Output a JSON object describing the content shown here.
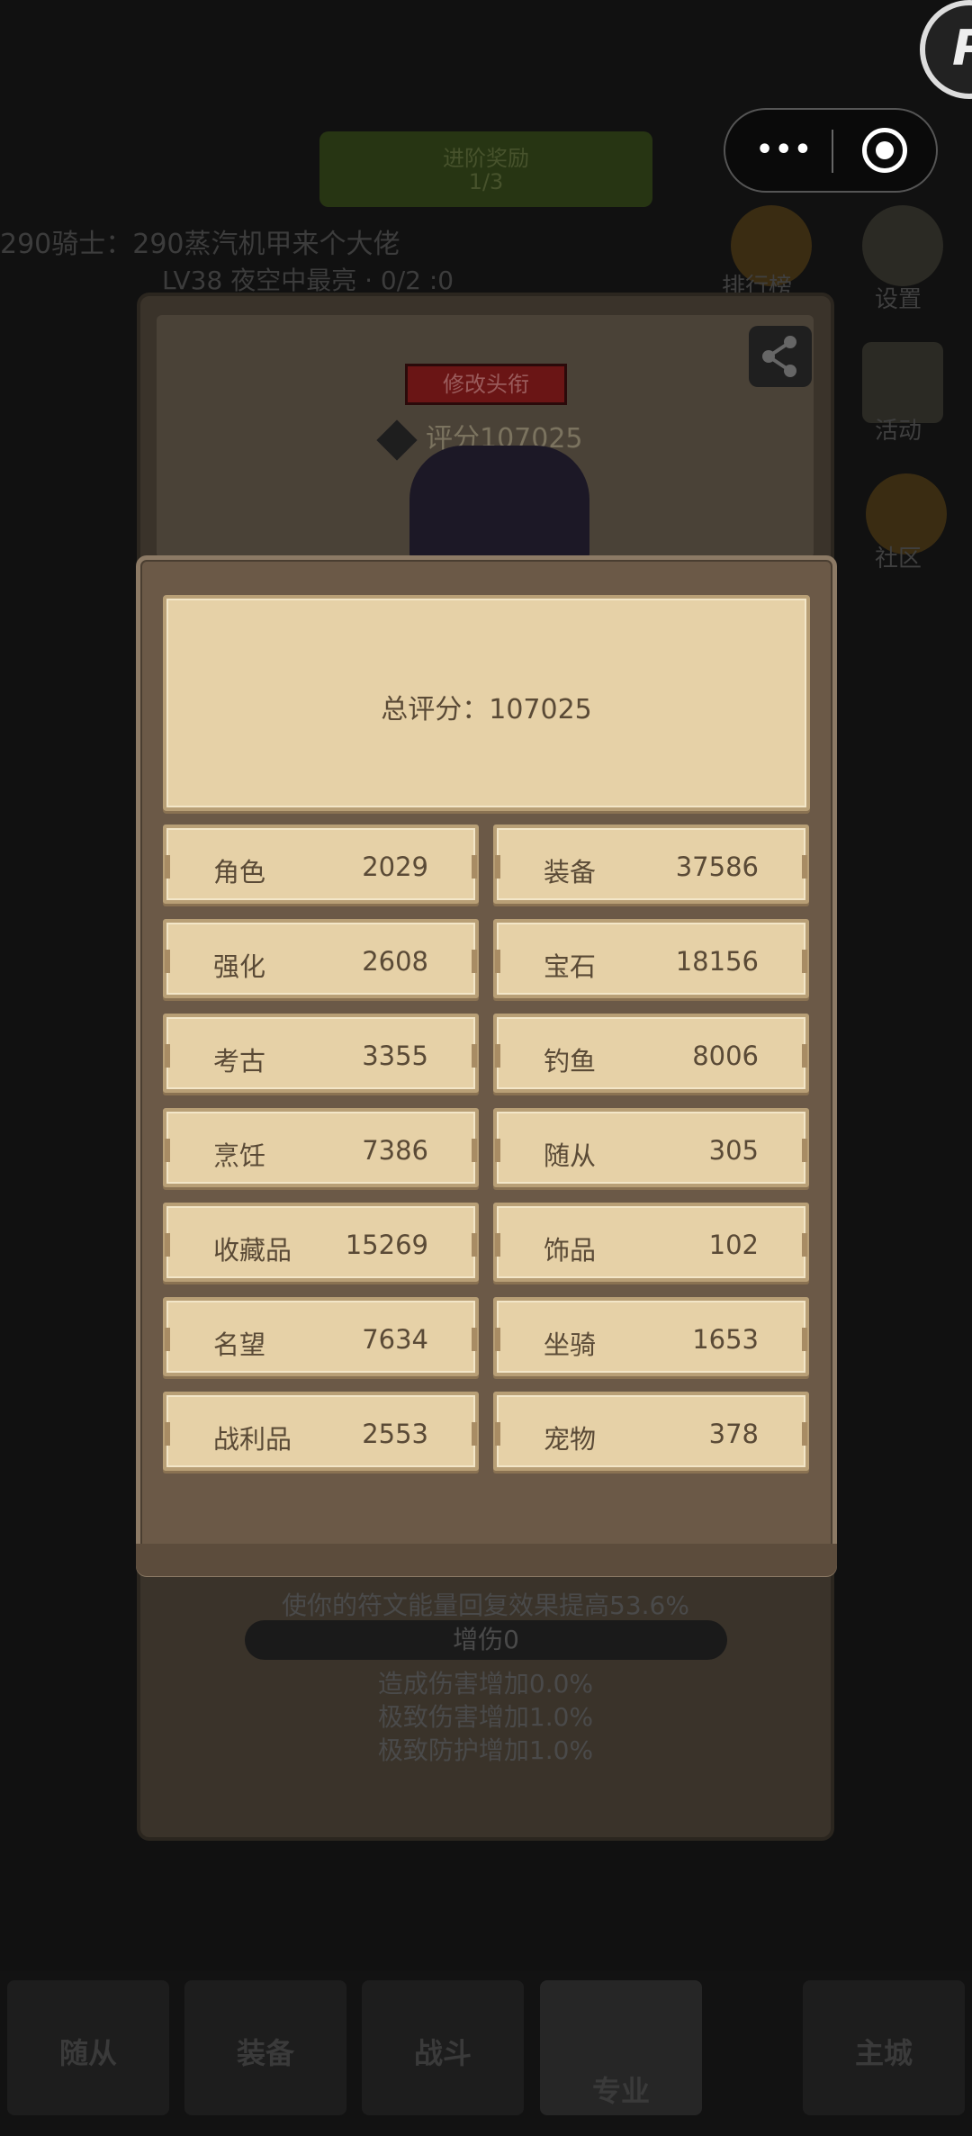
{
  "background": {
    "top_button_line1": "进阶奖励",
    "top_button_line2": "1/3",
    "marquee_line1": "290骑士：290蒸汽机甲来个大佬",
    "marquee_line2": "LV38 夜空中最亮 · 0/2  :0",
    "side_labels": [
      "排行榜",
      "设置",
      "活动",
      "社区"
    ],
    "profile_title_button": "修改头衔",
    "profile_rating": "评分107025",
    "effect_text": "使你的符文能量回复效果提高53.6%",
    "damage_bar": "增伤0",
    "stat_line1": "造成伤害增加0.0%",
    "stat_line2": "极致伤害增加1.0%",
    "stat_line3": "极致防护增加1.0%"
  },
  "bottom_nav": [
    "随从",
    "装备",
    "战斗",
    "专业",
    "主城"
  ],
  "modal": {
    "total_score": "总评分：107025",
    "rows": [
      {
        "left": {
          "name": "角色",
          "value": "2029"
        },
        "right": {
          "name": "装备",
          "value": "37586"
        }
      },
      {
        "left": {
          "name": "强化",
          "value": "2608"
        },
        "right": {
          "name": "宝石",
          "value": "18156"
        }
      },
      {
        "left": {
          "name": "考古",
          "value": "3355"
        },
        "right": {
          "name": "钓鱼",
          "value": "8006"
        }
      },
      {
        "left": {
          "name": "烹饪",
          "value": "7386"
        },
        "right": {
          "name": "随从",
          "value": "305"
        }
      },
      {
        "left": {
          "name": "收藏品",
          "value": "15269"
        },
        "right": {
          "name": "饰品",
          "value": "102"
        }
      },
      {
        "left": {
          "name": "名望",
          "value": "7634"
        },
        "right": {
          "name": "坐骑",
          "value": "1653"
        }
      },
      {
        "left": {
          "name": "战利品",
          "value": "2553"
        },
        "right": {
          "name": "宠物",
          "value": "378"
        }
      }
    ]
  },
  "capsule": {
    "more_icon": "more-dots-icon",
    "close_icon": "target-close-icon"
  }
}
